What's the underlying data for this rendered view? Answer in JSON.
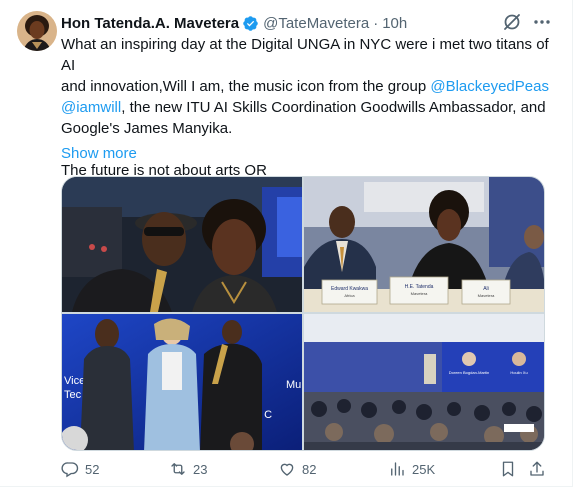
{
  "author": {
    "name": "Hon Tatenda.A. Mavetera",
    "handle": "@TateMavetera",
    "separator": "·",
    "time": "10h",
    "verified_icon": "verified-badge-icon"
  },
  "tweet": {
    "line1": "What an inspiring day at the Digital UNGA in NYC were i met two titans of AI",
    "line2": "and innovation,Will I am, the music icon from the group ",
    "mention1": "@BlackeyedPeas",
    "mention2": "@iamwill",
    "line3_rest": ", the new ITU AI Skills Coordination Goodwills Ambassador, and",
    "line4": "Google's James Manyika.",
    "line5": "The future is not about arts OR",
    "show_more": "Show more"
  },
  "media": {
    "photo1": {
      "icon": "photo-selfie-image"
    },
    "photo2": {
      "icon": "photo-panel-table-image",
      "placard1_line1": "Edward Kwakwa",
      "placard1_line2": "Africa",
      "placard2_line1": "H.E. Tatenda",
      "placard2_line2": "Mavetera",
      "placard3_line1": "Ali",
      "placard3_line2": "Mavetera"
    },
    "photo3": {
      "icon": "photo-group-image",
      "banner_line1": "Vice",
      "banner_line2": "Tec",
      "banner_right1": "Mu",
      "banner_right2": "AI Skills C"
    },
    "photo4": {
      "icon": "photo-conference-room-image",
      "screen_name1": "Doreen Bogdan-Martin",
      "screen_name2": "Houlin Xu"
    }
  },
  "actions": {
    "replies": "52",
    "reposts": "23",
    "likes": "82",
    "views": "25K"
  },
  "colors": {
    "link": "#1d9bf0",
    "muted": "#536471",
    "text": "#0f1419",
    "verified": "#1d9bf0"
  }
}
